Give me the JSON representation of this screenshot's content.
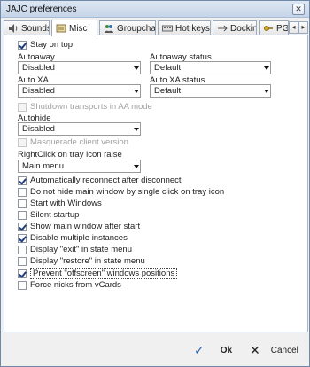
{
  "window": {
    "title": "JAJC preferences"
  },
  "tabs": [
    {
      "label": "Sounds"
    },
    {
      "label": "Misc"
    },
    {
      "label": "Groupchat"
    },
    {
      "label": "Hot keys"
    },
    {
      "label": "Docking"
    },
    {
      "label": "PGP"
    }
  ],
  "misc": {
    "stay_on_top": "Stay on top",
    "autoaway_label": "Autoaway",
    "autoaway_value": "Disabled",
    "autoaway_status_label": "Autoaway status",
    "autoaway_status_value": "Default",
    "autoxa_label": "Auto XA",
    "autoxa_value": "Disabled",
    "autoxa_status_label": "Auto XA status",
    "autoxa_status_value": "Default",
    "shutdown_transports": "Shutdown transports in AA mode",
    "autohide_label": "Autohide",
    "autohide_value": "Disabled",
    "masquerade": "Masquerade client version",
    "rightclick_label": "RightClick on tray icon raise",
    "rightclick_value": "Main menu",
    "options": [
      {
        "label": "Automatically reconnect after disconnect",
        "checked": true
      },
      {
        "label": "Do not hide main window by single click on tray icon",
        "checked": false
      },
      {
        "label": "Start with Windows",
        "checked": false
      },
      {
        "label": "Silent startup",
        "checked": false
      },
      {
        "label": "Show main window after start",
        "checked": true
      },
      {
        "label": "Disable multiple instances",
        "checked": true
      },
      {
        "label": "Display \"exit\" in state menu",
        "checked": false
      },
      {
        "label": "Display \"restore\" in state menu",
        "checked": false
      },
      {
        "label": "Prevent \"offscreen\" windows positions",
        "checked": true
      },
      {
        "label": "Force nicks from vCards",
        "checked": false
      }
    ]
  },
  "buttons": {
    "ok": "Ok",
    "cancel": "Cancel"
  }
}
